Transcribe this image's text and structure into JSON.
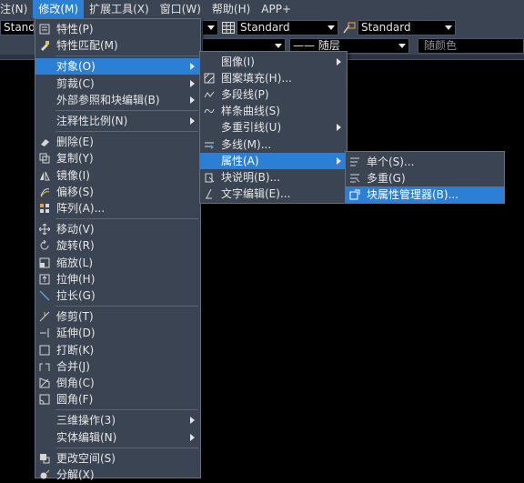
{
  "menubar": {
    "items": [
      "注(N)",
      "修改(M)",
      "扩展工具(X)",
      "窗口(W)",
      "帮助(H)",
      "APP+"
    ]
  },
  "toolbar": {
    "style_combo_left": "Standa",
    "style_combo_mid": "Standard",
    "style_combo_right": "Standard",
    "layer_combo": "—— 随层",
    "color_combo": "随颜色"
  },
  "menu_modify": {
    "items": [
      {
        "label": "特性(P)",
        "icon": "properties-icon"
      },
      {
        "label": "特性匹配(M)",
        "icon": "match-properties-icon"
      },
      {
        "label": "对象(O)",
        "icon": "",
        "submenu": true,
        "highlighted": true
      },
      {
        "label": "剪裁(C)",
        "icon": "",
        "submenu": true
      },
      {
        "label": "外部参照和块编辑(B)",
        "icon": "",
        "submenu": true
      },
      {
        "label": "注释性比例(N)",
        "icon": "",
        "submenu": true
      },
      {
        "label": "删除(E)",
        "icon": "eraser-icon"
      },
      {
        "label": "复制(Y)",
        "icon": "copy-icon"
      },
      {
        "label": "镜像(I)",
        "icon": "mirror-icon"
      },
      {
        "label": "偏移(S)",
        "icon": "offset-icon"
      },
      {
        "label": "阵列(A)...",
        "icon": "array-icon"
      },
      {
        "label": "移动(V)",
        "icon": "move-icon"
      },
      {
        "label": "旋转(R)",
        "icon": "rotate-icon"
      },
      {
        "label": "缩放(L)",
        "icon": "scale-icon"
      },
      {
        "label": "拉伸(H)",
        "icon": "stretch-icon"
      },
      {
        "label": "拉长(G)",
        "icon": "lengthen-icon"
      },
      {
        "label": "修剪(T)",
        "icon": "trim-icon"
      },
      {
        "label": "延伸(D)",
        "icon": "extend-icon"
      },
      {
        "label": "打断(K)",
        "icon": "break-icon"
      },
      {
        "label": "合并(J)",
        "icon": "join-icon"
      },
      {
        "label": "倒角(C)",
        "icon": "chamfer-icon"
      },
      {
        "label": "圆角(F)",
        "icon": "fillet-icon"
      },
      {
        "label": "三维操作(3)",
        "icon": "",
        "submenu": true
      },
      {
        "label": "实体编辑(N)",
        "icon": "",
        "submenu": true
      },
      {
        "label": "更改空间(S)",
        "icon": "change-space-icon"
      },
      {
        "label": "分解(X)",
        "icon": "explode-icon"
      }
    ]
  },
  "menu_object": {
    "items": [
      {
        "label": "图像(I)",
        "icon": "",
        "submenu": true
      },
      {
        "label": "图案填充(H)...",
        "icon": "hatch-icon"
      },
      {
        "label": "多段线(P)",
        "icon": "polyline-icon"
      },
      {
        "label": "样条曲线(S)",
        "icon": "spline-icon"
      },
      {
        "label": "多重引线(U)",
        "icon": "",
        "submenu": true
      },
      {
        "label": "多线(M)...",
        "icon": "multiline-icon"
      },
      {
        "label": "属性(A)",
        "icon": "",
        "submenu": true,
        "highlighted": true
      },
      {
        "label": "块说明(B)...",
        "icon": "block-description-icon"
      },
      {
        "label": "文字编辑(E)...",
        "icon": "text-edit-icon"
      }
    ]
  },
  "menu_attribute": {
    "items": [
      {
        "label": "单个(S)...",
        "icon": "single-attribute-icon"
      },
      {
        "label": "多重(G)",
        "icon": "multiple-attribute-icon"
      },
      {
        "label": "块属性管理器(B)...",
        "icon": "block-attribute-manager-icon",
        "highlighted": true
      }
    ]
  }
}
